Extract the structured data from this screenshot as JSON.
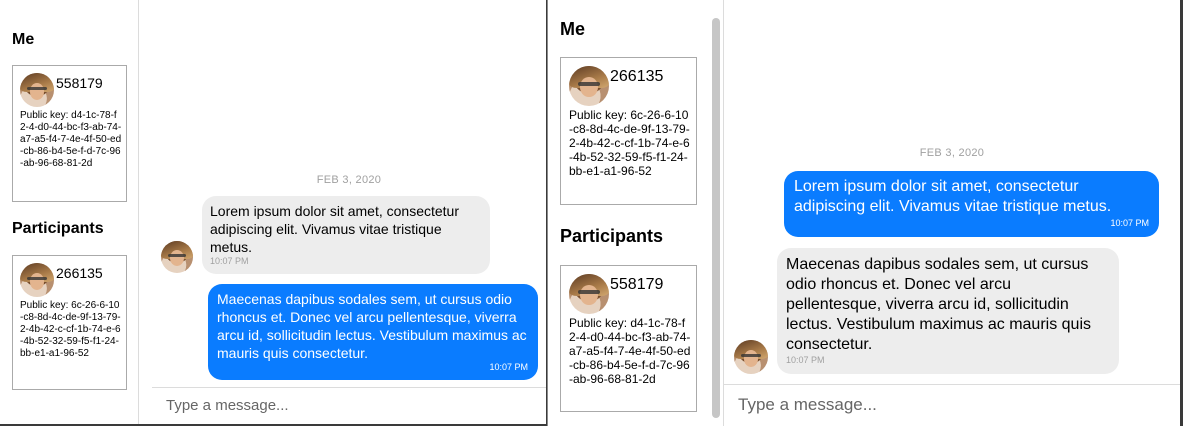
{
  "left": {
    "me_title": "Me",
    "me": {
      "id": "558179",
      "public_key": "Public key: d4-1c-78-f2-4-d0-44-bc-f3-ab-74-a7-a5-f4-7-4e-4f-50-ed-cb-86-b4-5e-f-d-7c-96-ab-96-68-81-2d"
    },
    "participants_title": "Participants",
    "participants": [
      {
        "id": "266135",
        "public_key": "Public key: 6c-26-6-10-c8-8d-4c-de-9f-13-79-2-4b-42-c-cf-1b-74-e-6-4b-52-32-59-f5-f1-24-bb-e1-a1-96-52"
      }
    ],
    "chat": {
      "date": "FEB 3, 2020",
      "messages": [
        {
          "direction": "incoming",
          "text": "Lorem ipsum dolor sit amet, consectetur adipiscing elit. Vivamus vitae tristique metus.",
          "time": "10:07 PM"
        },
        {
          "direction": "outgoing",
          "text": "Maecenas dapibus sodales sem, ut cursus odio rhoncus et. Donec vel arcu pellentesque, viverra arcu id, sollicitudin lectus. Vestibulum maximus ac mauris quis consectetur.",
          "time": "10:07 PM"
        }
      ],
      "composer_placeholder": "Type a message..."
    }
  },
  "right": {
    "me_title": "Me",
    "me": {
      "id": "266135",
      "public_key": "Public key: 6c-26-6-10-c8-8d-4c-de-9f-13-79-2-4b-42-c-cf-1b-74-e-6-4b-52-32-59-f5-f1-24-bb-e1-a1-96-52"
    },
    "participants_title": "Participants",
    "participants": [
      {
        "id": "558179",
        "public_key": "Public key: d4-1c-78-f2-4-d0-44-bc-f3-ab-74-a7-a5-f4-7-4e-4f-50-ed-cb-86-b4-5e-f-d-7c-96-ab-96-68-81-2d"
      }
    ],
    "chat": {
      "date": "FEB 3, 2020",
      "messages": [
        {
          "direction": "outgoing",
          "text": "Lorem ipsum dolor sit amet, consectetur adipiscing elit. Vivamus vitae tristique metus.",
          "time": "10:07 PM"
        },
        {
          "direction": "incoming",
          "text": "Maecenas dapibus sodales sem, ut cursus odio rhoncus et. Donec vel arcu pellentesque, viverra arcu id, sollicitudin lectus. Vestibulum maximus ac mauris quis consectetur.",
          "time": "10:07 PM"
        }
      ],
      "composer_placeholder": "Type a message..."
    }
  },
  "colors": {
    "outgoing_bubble": "#0a7cff",
    "incoming_bubble": "#ededed",
    "timestamp_gray": "#a0a0a0"
  }
}
